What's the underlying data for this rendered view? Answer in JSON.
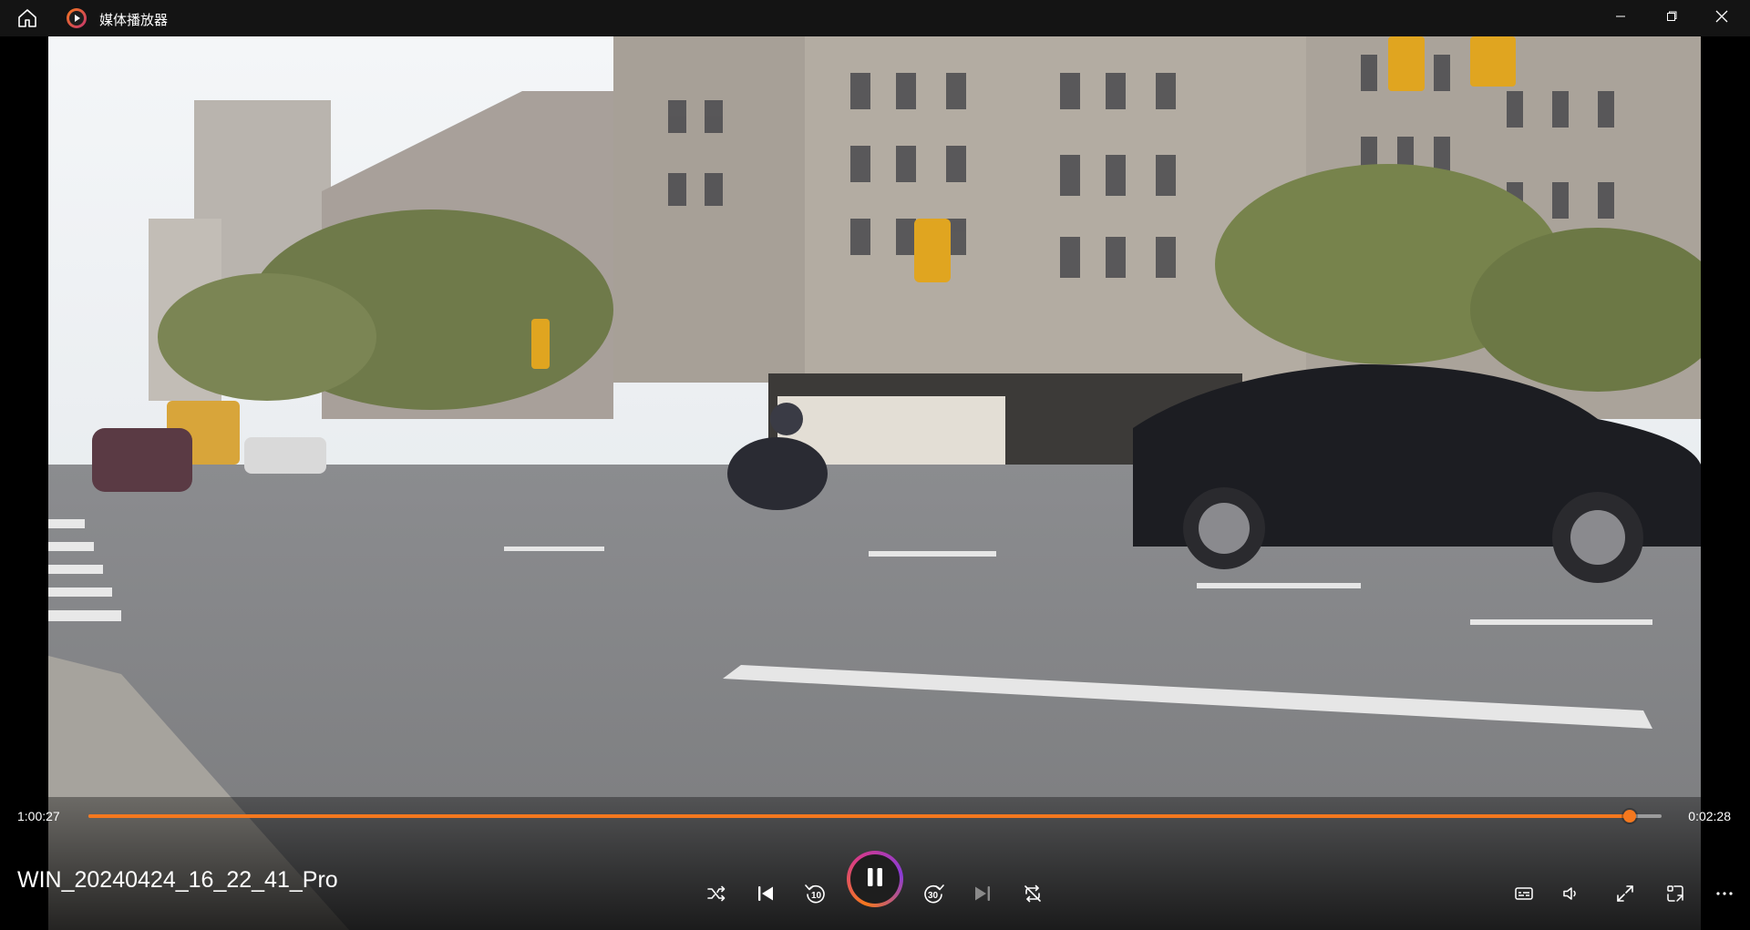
{
  "window": {
    "title": "媒体播放器",
    "icons": {
      "home": "home-icon",
      "app": "media-player-app-icon",
      "minimize": "minimize-icon",
      "maximize": "maximize-icon",
      "close": "close-icon"
    }
  },
  "player": {
    "current_time": "1:00:27",
    "remaining_time": "0:02:28",
    "progress": 0.98,
    "file_name": "WIN_20240424_16_22_41_Pro",
    "accent_color": "#f5781e",
    "state": "playing",
    "skip_back_seconds": "10",
    "skip_forward_seconds": "30"
  },
  "controls": {
    "left_group": [
      "shuffle-icon",
      "previous-icon",
      "rewind-10-icon"
    ],
    "center": "pause-icon",
    "right_group": [
      "forward-30-icon",
      "next-icon",
      "repeat-off-icon"
    ],
    "tools": [
      "subtitles-icon",
      "volume-icon",
      "fullscreen-icon",
      "miniplayer-icon",
      "more-icon"
    ]
  }
}
